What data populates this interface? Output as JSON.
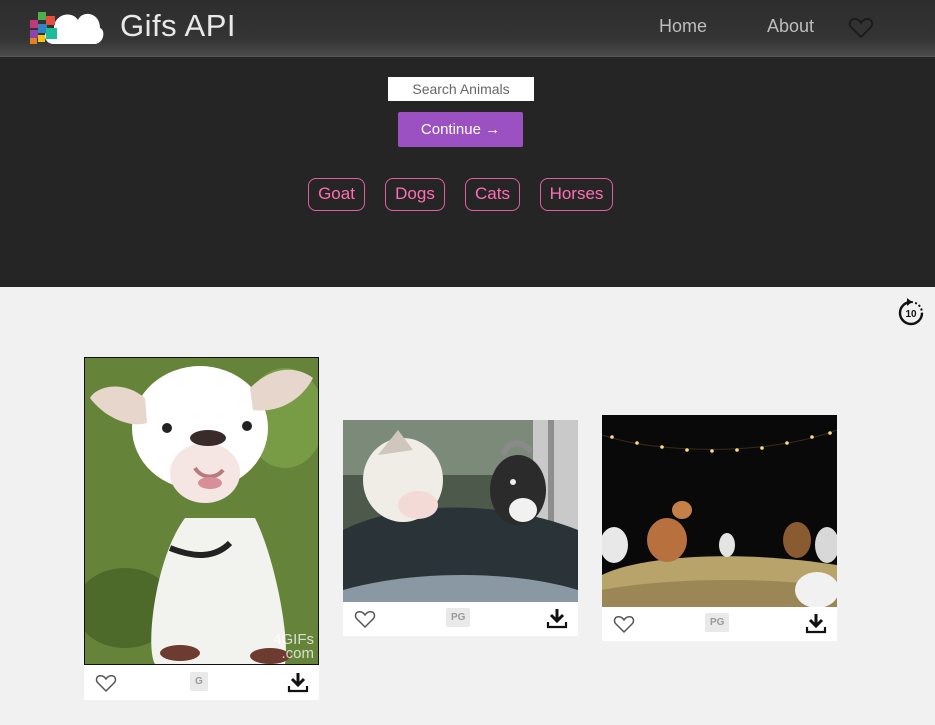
{
  "app": {
    "title": "Gifs API"
  },
  "nav": {
    "home": "Home",
    "about": "About"
  },
  "search": {
    "placeholder": "Search Animals",
    "value": "",
    "button_label": "Continue →"
  },
  "tags": [
    "Goat",
    "Dogs",
    "Cats",
    "Horses"
  ],
  "gifs": [
    {
      "rating": "G",
      "watermark_line1": "4GIFs",
      "watermark_line2": ".com"
    },
    {
      "rating": "PG"
    },
    {
      "rating": "PG"
    }
  ],
  "colors": {
    "accent_button": "#9b51c1",
    "tag_border": "#e0609f",
    "tag_text": "#ff6eb4",
    "hero_bg": "#262526",
    "navbar_bg": "#333333",
    "content_bg": "#f1f1f1"
  },
  "icons": [
    "cloud-logo-icon",
    "heart-icon",
    "replay-10-icon",
    "download-icon"
  ]
}
